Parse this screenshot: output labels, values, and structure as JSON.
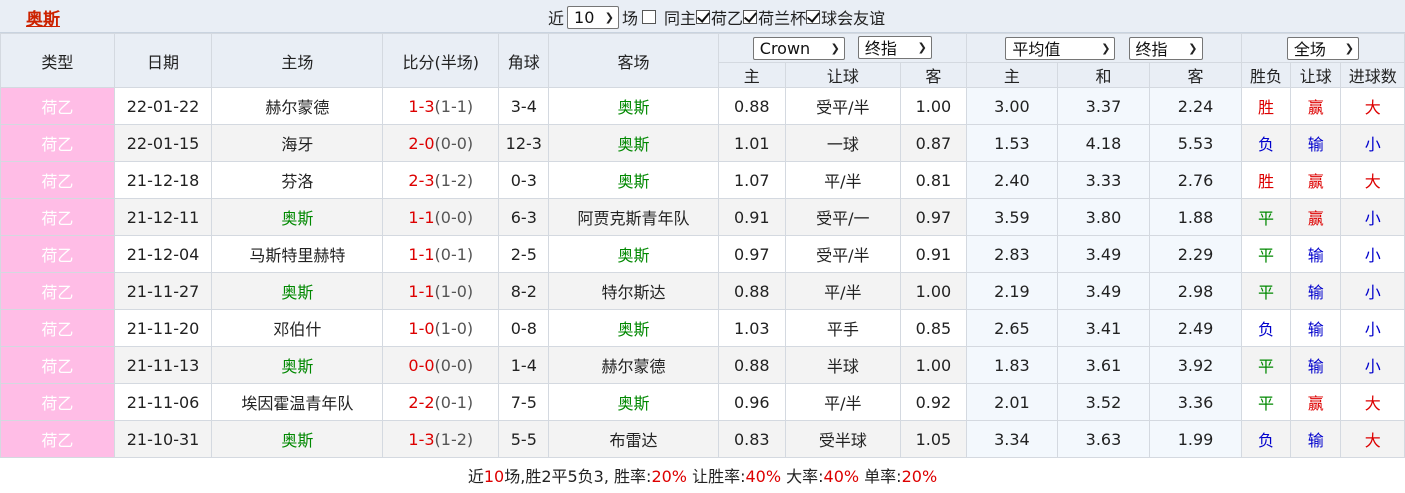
{
  "team_title": "奥斯",
  "filters": {
    "recent_prefix": "近",
    "recent_count": "10",
    "recent_suffix": "场",
    "same_home_label": "同主",
    "same_home_checked": false,
    "league_options": [
      {
        "label": "荷乙",
        "checked": true
      },
      {
        "label": "荷兰杯",
        "checked": true
      },
      {
        "label": "球会友谊",
        "checked": true
      }
    ]
  },
  "headers": {
    "type": "类型",
    "date": "日期",
    "home": "主场",
    "score": "比分(半场)",
    "corner": "角球",
    "away": "客场",
    "company_select": "Crown",
    "handicap_select": "终指",
    "avg_select": "平均值",
    "avg_final_select": "终指",
    "scope_select": "全场",
    "sub": {
      "h_home": "主",
      "h_handicap": "让球",
      "h_away": "客",
      "o_home": "主",
      "o_draw": "和",
      "o_away": "客",
      "result": "胜负",
      "handicap_result": "让球",
      "goals": "进球数"
    }
  },
  "colors": {
    "type_bg": "#ffbde6",
    "team_highlight": "#008800",
    "win": "#dd0000",
    "lose": "#0000cc",
    "draw": "#008800"
  },
  "rows": [
    {
      "type": "荷乙",
      "date": "22-01-22",
      "home": "赫尔蒙德",
      "home_hl": false,
      "score": "1-3",
      "half": "(1-1)",
      "corner": "3-4",
      "away": "奥斯",
      "away_hl": true,
      "h_home": "0.88",
      "h_line": "受平/半",
      "h_away": "1.00",
      "o_home": "3.00",
      "o_draw": "3.37",
      "o_away": "2.24",
      "result": "胜",
      "result_c": "red",
      "hres": "赢",
      "hres_c": "red",
      "goals": "大",
      "goals_c": "red"
    },
    {
      "type": "荷乙",
      "date": "22-01-15",
      "home": "海牙",
      "home_hl": false,
      "score": "2-0",
      "half": "(0-0)",
      "corner": "12-3",
      "away": "奥斯",
      "away_hl": true,
      "h_home": "1.01",
      "h_line": "一球",
      "h_away": "0.87",
      "o_home": "1.53",
      "o_draw": "4.18",
      "o_away": "5.53",
      "result": "负",
      "result_c": "blue",
      "hres": "输",
      "hres_c": "blue",
      "goals": "小",
      "goals_c": "blue"
    },
    {
      "type": "荷乙",
      "date": "21-12-18",
      "home": "芬洛",
      "home_hl": false,
      "score": "2-3",
      "half": "(1-2)",
      "corner": "0-3",
      "away": "奥斯",
      "away_hl": true,
      "h_home": "1.07",
      "h_line": "平/半",
      "h_away": "0.81",
      "o_home": "2.40",
      "o_draw": "3.33",
      "o_away": "2.76",
      "result": "胜",
      "result_c": "red",
      "hres": "赢",
      "hres_c": "red",
      "goals": "大",
      "goals_c": "red"
    },
    {
      "type": "荷乙",
      "date": "21-12-11",
      "home": "奥斯",
      "home_hl": true,
      "score": "1-1",
      "half": "(0-0)",
      "corner": "6-3",
      "away": "阿贾克斯青年队",
      "away_hl": false,
      "h_home": "0.91",
      "h_line": "受平/一",
      "h_away": "0.97",
      "o_home": "3.59",
      "o_draw": "3.80",
      "o_away": "1.88",
      "result": "平",
      "result_c": "green",
      "hres": "赢",
      "hres_c": "red",
      "goals": "小",
      "goals_c": "blue"
    },
    {
      "type": "荷乙",
      "date": "21-12-04",
      "home": "马斯特里赫特",
      "home_hl": false,
      "score": "1-1",
      "half": "(0-1)",
      "corner": "2-5",
      "away": "奥斯",
      "away_hl": true,
      "h_home": "0.97",
      "h_line": "受平/半",
      "h_away": "0.91",
      "o_home": "2.83",
      "o_draw": "3.49",
      "o_away": "2.29",
      "result": "平",
      "result_c": "green",
      "hres": "输",
      "hres_c": "blue",
      "goals": "小",
      "goals_c": "blue"
    },
    {
      "type": "荷乙",
      "date": "21-11-27",
      "home": "奥斯",
      "home_hl": true,
      "score": "1-1",
      "half": "(1-0)",
      "corner": "8-2",
      "away": "特尔斯达",
      "away_hl": false,
      "h_home": "0.88",
      "h_line": "平/半",
      "h_away": "1.00",
      "o_home": "2.19",
      "o_draw": "3.49",
      "o_away": "2.98",
      "result": "平",
      "result_c": "green",
      "hres": "输",
      "hres_c": "blue",
      "goals": "小",
      "goals_c": "blue"
    },
    {
      "type": "荷乙",
      "date": "21-11-20",
      "home": "邓伯什",
      "home_hl": false,
      "score": "1-0",
      "half": "(1-0)",
      "corner": "0-8",
      "away": "奥斯",
      "away_hl": true,
      "h_home": "1.03",
      "h_line": "平手",
      "h_away": "0.85",
      "o_home": "2.65",
      "o_draw": "3.41",
      "o_away": "2.49",
      "result": "负",
      "result_c": "blue",
      "hres": "输",
      "hres_c": "blue",
      "goals": "小",
      "goals_c": "blue"
    },
    {
      "type": "荷乙",
      "date": "21-11-13",
      "home": "奥斯",
      "home_hl": true,
      "score": "0-0",
      "half": "(0-0)",
      "corner": "1-4",
      "away": "赫尔蒙德",
      "away_hl": false,
      "h_home": "0.88",
      "h_line": "半球",
      "h_away": "1.00",
      "o_home": "1.83",
      "o_draw": "3.61",
      "o_away": "3.92",
      "result": "平",
      "result_c": "green",
      "hres": "输",
      "hres_c": "blue",
      "goals": "小",
      "goals_c": "blue"
    },
    {
      "type": "荷乙",
      "date": "21-11-06",
      "home": "埃因霍温青年队",
      "home_hl": false,
      "score": "2-2",
      "half": "(0-1)",
      "corner": "7-5",
      "away": "奥斯",
      "away_hl": true,
      "h_home": "0.96",
      "h_line": "平/半",
      "h_away": "0.92",
      "o_home": "2.01",
      "o_draw": "3.52",
      "o_away": "3.36",
      "result": "平",
      "result_c": "green",
      "hres": "赢",
      "hres_c": "red",
      "goals": "大",
      "goals_c": "red"
    },
    {
      "type": "荷乙",
      "date": "21-10-31",
      "home": "奥斯",
      "home_hl": true,
      "score": "1-3",
      "half": "(1-2)",
      "corner": "5-5",
      "away": "布雷达",
      "away_hl": false,
      "h_home": "0.83",
      "h_line": "受半球",
      "h_away": "1.05",
      "o_home": "3.34",
      "o_draw": "3.63",
      "o_away": "1.99",
      "result": "负",
      "result_c": "blue",
      "hres": "输",
      "hres_c": "blue",
      "goals": "大",
      "goals_c": "red"
    }
  ],
  "footer": {
    "prefix": "近",
    "count": "10",
    "mid": "场,胜2平5负3, 胜率:",
    "win_rate": "20%",
    "hwin_label": " 让胜率:",
    "hwin_rate": "40%",
    "big_label": " 大率:",
    "big_rate": "40%",
    "odd_label": " 单率:",
    "odd_rate": "20%"
  }
}
